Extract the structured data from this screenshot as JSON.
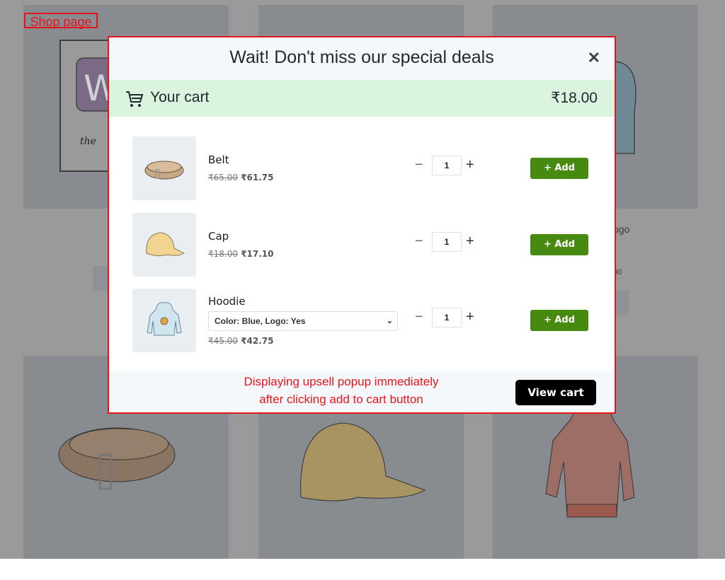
{
  "background": {
    "annotation_label": "Shop page",
    "visible_text_fragments": [
      "ogo",
      "00"
    ]
  },
  "popup": {
    "title": "Wait! Don't miss our special deals",
    "close_icon": "close-icon",
    "cart": {
      "icon": "cart-icon",
      "label": "Your cart",
      "total": "₹18.00"
    },
    "items": [
      {
        "name": "Belt",
        "icon": "belt-image",
        "regular_price": "₹65.00",
        "sale_price": "₹61.75",
        "quantity": "1",
        "add_label": "+ Add"
      },
      {
        "name": "Cap",
        "icon": "cap-image",
        "regular_price": "₹18.00",
        "sale_price": "₹17.10",
        "quantity": "1",
        "add_label": "+ Add"
      },
      {
        "name": "Hoodie",
        "icon": "hoodie-image",
        "variant": "Color: Blue, Logo: Yes",
        "regular_price": "₹45.00",
        "sale_price": "₹42.75",
        "quantity": "1",
        "add_label": "+ Add"
      }
    ],
    "qty_minus": "−",
    "qty_plus": "+",
    "footer_note_line1": "Displaying upsell popup immediately",
    "footer_note_line2": "after clicking add to cart button",
    "view_cart_label": "View cart"
  },
  "colors": {
    "accent_red": "#e8141b",
    "add_button": "#478a10",
    "cart_bar": "#dbf4de",
    "view_cart": "#000000"
  }
}
